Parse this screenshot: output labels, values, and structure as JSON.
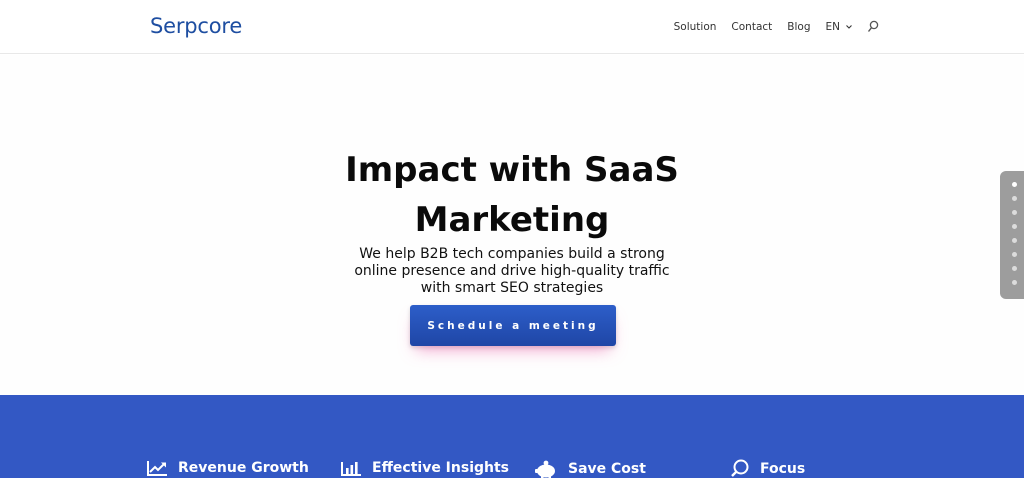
{
  "brand": {
    "name": "Serpcore",
    "color": "#1e4ea1"
  },
  "nav": {
    "items": [
      {
        "label": "Solution"
      },
      {
        "label": "Contact"
      },
      {
        "label": "Blog"
      }
    ],
    "language": "EN",
    "search_icon": "search-icon"
  },
  "hero": {
    "title_line1": "Impact with SaaS",
    "title_line2": "Marketing",
    "subtitle_line1": "We help B2B tech companies build a strong",
    "subtitle_line2": "online presence and drive high-quality traffic",
    "subtitle_line3": "with smart SEO strategies",
    "cta_label": "Schedule a meeting"
  },
  "section_nav": {
    "count": 8,
    "active_index": 0
  },
  "features": [
    {
      "label": "Revenue Growth",
      "icon": "trending-up-chart-icon"
    },
    {
      "label": "Effective Insights",
      "icon": "bar-chart-icon"
    },
    {
      "label": "Save Cost",
      "icon": "piggy-bank-icon"
    },
    {
      "label": "Focus",
      "icon": "magnifier-icon"
    }
  ],
  "colors": {
    "band": "#3358c4",
    "cta": "#2552b8"
  }
}
